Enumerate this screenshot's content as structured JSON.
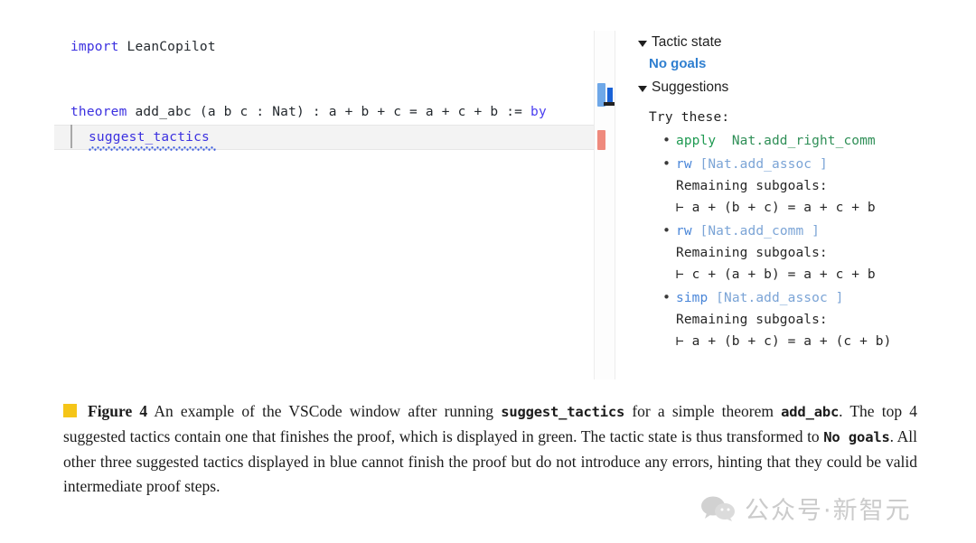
{
  "figure": {
    "editor": {
      "lines": [
        {
          "id": "import",
          "keyword": "import",
          "rest": " LeanCopilot"
        },
        {
          "id": "theorem",
          "keyword": "theorem",
          "rest": " add_abc (a b c : Nat) : a + b + c = a + c + b := ",
          "keyword_end": "by"
        },
        {
          "id": "tactic",
          "text": "suggest_tactics"
        }
      ],
      "minimap": {
        "marker_info_color": "#6fa8e8",
        "marker_error_color": "#ef8a7d",
        "cursor_color": "#1a62d6"
      },
      "diagnostic_underline_color": "#3355dd"
    },
    "panel": {
      "tactic_state_label": "Tactic state",
      "tactic_state_value": "No goals",
      "tactic_state_value_color": "#2f7fd0",
      "suggestions_label": "Suggestions",
      "try_these_label": "Try these:",
      "suggestions": [
        {
          "tactic": "apply",
          "argument": "Nat.add_right_comm",
          "color": "#1f9a52",
          "status": "closes-goal",
          "subgoal_label": "",
          "subgoal_expr": ""
        },
        {
          "tactic": "rw",
          "argument": "[Nat.add_assoc ]",
          "color": "#4a86d8",
          "status": "remaining",
          "subgoal_label": "Remaining subgoals:",
          "subgoal_expr": "⊢ a + (b + c) = a + c + b"
        },
        {
          "tactic": "rw",
          "argument": "[Nat.add_comm ]",
          "color": "#4a86d8",
          "status": "remaining",
          "subgoal_label": "Remaining subgoals:",
          "subgoal_expr": "⊢ c + (a + b) = a + c + b"
        },
        {
          "tactic": "simp",
          "argument": "[Nat.add_assoc ]",
          "color": "#4a86d8",
          "status": "remaining",
          "subgoal_label": "Remaining subgoals:",
          "subgoal_expr": "⊢ a + (b + c) = a + (c + b)"
        }
      ]
    }
  },
  "caption": {
    "swatch_color": "#f5c518",
    "label": "Figure 4",
    "part1": " An example of the VSCode window after running ",
    "mono1": "suggest_tactics",
    "part2": " for a simple theorem ",
    "mono2": "add_abc",
    "part3": ". The top 4 suggested tactics contain one that finishes the proof, which is displayed in green. The tactic state is thus transformed to ",
    "mono3": "No goals",
    "part4": ". All other three suggested tactics displayed in blue cannot finish the proof but do not introduce any errors, hinting that they could be valid intermediate proof steps."
  },
  "watermark": {
    "text": "公众号·新智元"
  }
}
